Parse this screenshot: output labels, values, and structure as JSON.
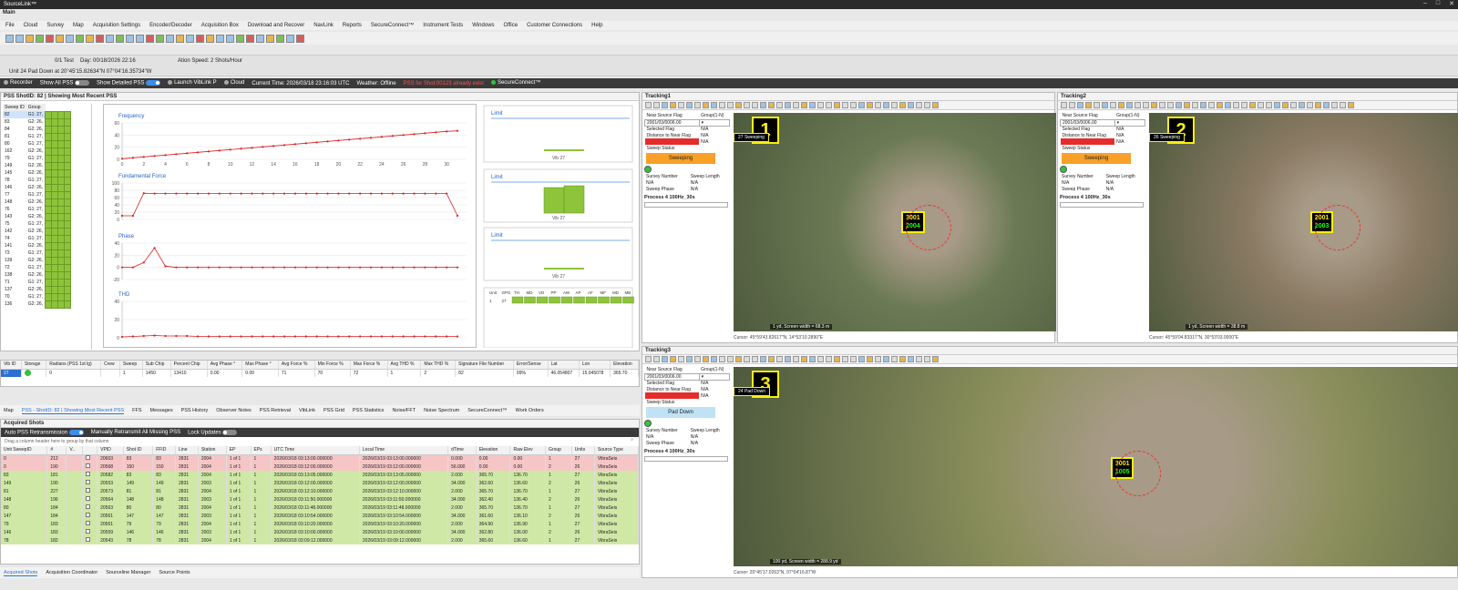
{
  "window": {
    "title": "SourceLink™",
    "main_label": "Main"
  },
  "menu": [
    "File",
    "Cloud",
    "Survey",
    "Map",
    "Acquisition Settings",
    "Encoder/Decoder",
    "Acquisition Box",
    "Download and Recover",
    "NavLink",
    "Reports",
    "SecureConnect™",
    "Instrument Tests",
    "Windows",
    "Office",
    "Customer Connections",
    "Help"
  ],
  "infobar": {
    "test_label": "0/1 Test",
    "day": "Day: 00/18/2026 22:16",
    "speed": "Ation Speed: 2 Shots/Hour",
    "unit_line": "Unit 24 Pad Down at 20°45'15.82634\"N 07°04'16.35734\"W"
  },
  "status": {
    "recorder": "Recorder",
    "show_all_pss": "Show All PSS",
    "show_detailed_pss": "Show Detailed PSS",
    "launch": "Launch VibLink P",
    "cloud": "Cloud",
    "current_time": "Current Time: 2026/03/18 23:16:03 UTC",
    "weather": "Weather: Offline",
    "alert": "PSS for Shot:00123 already exist",
    "secure": "SecureConnect™"
  },
  "pss_panel": {
    "header": "PSS  ShotID: 82  | Showing Most Recent PSS",
    "cols": [
      "Sweep ID",
      "Group"
    ],
    "rows": [
      [
        "82",
        "G1: 27,"
      ],
      [
        "83",
        "G2: 26,"
      ],
      [
        "84",
        "G2: 26,"
      ],
      [
        "81",
        "G1: 27,"
      ],
      [
        "80",
        "G1: 27,"
      ],
      [
        "162",
        "G2: 26,"
      ],
      [
        "79",
        "G1: 27,"
      ],
      [
        "149",
        "G2: 26,"
      ],
      [
        "145",
        "G2: 26,"
      ],
      [
        "78",
        "G1: 27,"
      ],
      [
        "146",
        "G2: 26,"
      ],
      [
        "77",
        "G1: 27,"
      ],
      [
        "148",
        "G2: 26,"
      ],
      [
        "76",
        "G1: 27,"
      ],
      [
        "143",
        "G2: 26,"
      ],
      [
        "75",
        "G1: 27,"
      ],
      [
        "142",
        "G2: 26,"
      ],
      [
        "74",
        "G1: 27,"
      ],
      [
        "141",
        "G2: 26,"
      ],
      [
        "73",
        "G1: 27,"
      ],
      [
        "139",
        "G2: 26,"
      ],
      [
        "72",
        "G1: 27,"
      ],
      [
        "138",
        "G2: 26,"
      ],
      [
        "71",
        "G1: 27,"
      ],
      [
        "137",
        "G2: 26,"
      ],
      [
        "70",
        "G1: 27,"
      ],
      [
        "136",
        "G2: 26,"
      ]
    ]
  },
  "charts": {
    "frequency_label": "Frequency",
    "force_label": "Fundamental Force",
    "phase_label": "Phase",
    "thd_label": "THD",
    "limit_label": "Limit",
    "vib_label": "Vib 27",
    "freq_y": [
      "60",
      "40",
      "20",
      "0"
    ],
    "x_ticks": [
      "0",
      "2",
      "4",
      "6",
      "8",
      "10",
      "12",
      "14",
      "16",
      "18",
      "20",
      "22",
      "24",
      "26",
      "28",
      "30"
    ],
    "force_y": [
      "100",
      "80",
      "60",
      "40",
      "20",
      "0"
    ],
    "phase_y": [
      "40",
      "20",
      "0",
      "-20"
    ],
    "thd_y": [
      "40",
      "20",
      "0"
    ]
  },
  "chart_data": [
    {
      "type": "line",
      "title": "Frequency",
      "x": [
        0,
        1,
        2,
        3,
        4,
        5,
        6,
        7,
        8,
        9,
        10,
        11,
        12,
        13,
        14,
        15,
        16,
        17,
        18,
        19,
        20,
        21,
        22,
        23,
        24,
        25,
        26,
        27,
        28,
        29,
        30,
        31
      ],
      "values": [
        1,
        2.5,
        4,
        5.5,
        7,
        8.5,
        10,
        11.5,
        13,
        14.5,
        16,
        17.5,
        19,
        20.5,
        22,
        23.5,
        25,
        26.5,
        28,
        29.5,
        31,
        32.5,
        34,
        35.5,
        37,
        38.5,
        40,
        41.5,
        43,
        44.5,
        46,
        47
      ],
      "ylim": [
        0,
        60
      ]
    },
    {
      "type": "line",
      "title": "Fundamental Force",
      "x": [
        0,
        1,
        2,
        3,
        4,
        5,
        6,
        7,
        8,
        9,
        10,
        11,
        12,
        13,
        14,
        15,
        16,
        17,
        18,
        19,
        20,
        21,
        22,
        23,
        24,
        25,
        26,
        27,
        28,
        29,
        30,
        31
      ],
      "values": [
        10,
        10,
        72,
        71,
        71,
        71,
        71,
        71,
        71,
        71,
        71,
        71,
        71,
        71,
        71,
        71,
        71,
        71,
        71,
        71,
        71,
        71,
        71,
        71,
        71,
        71,
        71,
        71,
        71,
        71,
        71,
        10
      ],
      "ylim": [
        0,
        100
      ]
    },
    {
      "type": "line",
      "title": "Phase",
      "x": [
        0,
        1,
        2,
        3,
        4,
        5,
        6,
        7,
        8,
        9,
        10,
        11,
        12,
        13,
        14,
        15,
        16,
        17,
        18,
        19,
        20,
        21,
        22,
        23,
        24,
        25,
        26,
        27,
        28,
        29,
        30,
        31
      ],
      "values": [
        0,
        0,
        8,
        32,
        2,
        0,
        0,
        0,
        0,
        0,
        0,
        0,
        0,
        0,
        0,
        0,
        0,
        0,
        0,
        0,
        0,
        0,
        0,
        0,
        0,
        0,
        0,
        0,
        0,
        0,
        0,
        0
      ],
      "ylim": [
        -20,
        40
      ]
    },
    {
      "type": "line",
      "title": "THD",
      "x": [
        0,
        1,
        2,
        3,
        4,
        5,
        6,
        7,
        8,
        9,
        10,
        11,
        12,
        13,
        14,
        15,
        16,
        17,
        18,
        19,
        20,
        21,
        22,
        23,
        24,
        25,
        26,
        27,
        28,
        29,
        30,
        31
      ],
      "values": [
        1,
        1.5,
        2,
        2.5,
        2,
        2,
        2,
        1.5,
        1.5,
        1.5,
        1.5,
        1.5,
        1.5,
        1.5,
        1.5,
        1.5,
        1.5,
        1.5,
        1.5,
        1.5,
        1.5,
        1.5,
        1.5,
        1.5,
        1.5,
        1.5,
        1.5,
        1.5,
        1.5,
        1.5,
        1.5,
        1.5
      ],
      "ylim": [
        0,
        40
      ]
    }
  ],
  "unit_strip": {
    "cols": [
      "Unit",
      "GPS",
      "TH",
      "MD",
      "VD",
      "PP",
      "AW",
      "AP",
      "AF",
      "MF",
      "MD",
      "MB"
    ],
    "row": [
      "1",
      "27"
    ]
  },
  "pss_detail": {
    "cols": [
      "Vib ID",
      "Storage",
      "Radians (PSS 1st lg)",
      "Crew",
      "Sweep",
      "Sub Chip",
      "Percent Chip",
      "Avg Phase °",
      "Max Phase °",
      "Avg Force %",
      "Min Force %",
      "Max Force %",
      "Avg THD %",
      "Max THD %",
      "Signature File Number",
      "Error/Sense",
      "Lat",
      "Lon",
      "Elevation"
    ],
    "row": [
      "27",
      "",
      "0",
      "",
      "1",
      "1450",
      "13410",
      "0.00",
      "0.00",
      "71",
      "70",
      "72",
      "1",
      "2",
      "82",
      "99%",
      "46.054807",
      "15.045078",
      "365.70"
    ]
  },
  "bottom_tabs": [
    "Map",
    "PSS - ShotID: 82  | Showing Most Recent PSS",
    "FFS",
    "Messages",
    "PSS History",
    "Observer Notes",
    "PSS Retrieval",
    "VibLink",
    "PSS Grid",
    "PSS Statistics",
    "Noise/FFT",
    "Noise Spectrum",
    "SecureConnect™",
    "Work Orders"
  ],
  "acquired": {
    "header": "Acquired Shots",
    "auto_pss": "Auto PSS Retransmission",
    "manual": "Manually Retransmit All Missing PSS",
    "lock": "Lock Updates",
    "group_hint": "Drag a column header here to group by that column",
    "cols": [
      "Unit SweepID",
      "#",
      "V..",
      "",
      "VPID",
      "Shot ID",
      "FFID",
      "Line",
      "Station",
      "EP",
      "EPs",
      "UTC Time",
      "Local Time",
      "dTime",
      "Elevation",
      "Raw Elev",
      "Group",
      "Units",
      "Source Type"
    ],
    "rows": [
      [
        "0",
        "212",
        "",
        "",
        "20603",
        "83",
        "83",
        "2831",
        "2004",
        "1 of 1",
        "1",
        "2026/03/18 03:13:00.000000",
        "2026/03/19 03:13:00.000000",
        "0.000",
        "0.00",
        "0.00",
        "1",
        "27",
        "VibraSeis"
      ],
      [
        "0",
        "190",
        "",
        "",
        "20568",
        "150",
        "150",
        "2831",
        "2004",
        "1 of 1",
        "1",
        "2026/03/18 03:12:00.000000",
        "2026/03/19 03:12:00.000000",
        "56.000",
        "0.00",
        "0.00",
        "2",
        "26",
        "VibraSeis"
      ],
      [
        "83",
        "181",
        "",
        "",
        "20582",
        "83",
        "83",
        "2831",
        "2004",
        "1 of 1",
        "1",
        "2026/03/18 03:13:05.000000",
        "2026/03/19 03:13:05.000000",
        "2.000",
        "365.70",
        "136.70",
        "1",
        "27",
        "VibraSeis"
      ],
      [
        "149",
        "190",
        "",
        "",
        "20553",
        "149",
        "149",
        "2831",
        "2003",
        "1 of 1",
        "1",
        "2026/03/18 03:12:00.000000",
        "2026/03/19 03:12:00.000000",
        "34.000",
        "362.60",
        "136.60",
        "2",
        "26",
        "VibraSeis"
      ],
      [
        "81",
        "227",
        "",
        "",
        "20573",
        "81",
        "81",
        "2831",
        "2004",
        "1 of 1",
        "1",
        "2026/03/18 03:12:10.000000",
        "2026/03/19 03:12:10.000000",
        "2.000",
        "365.70",
        "136.70",
        "1",
        "27",
        "VibraSeis"
      ],
      [
        "148",
        "196",
        "",
        "",
        "20564",
        "148",
        "148",
        "2831",
        "2003",
        "1 of 1",
        "1",
        "2026/03/18 03:11:50.000000",
        "2026/03/19 03:11:50.000000",
        "34.000",
        "362.40",
        "136.40",
        "2",
        "26",
        "VibraSeis"
      ],
      [
        "80",
        "184",
        "",
        "",
        "20563",
        "80",
        "80",
        "2831",
        "2004",
        "1 of 1",
        "1",
        "2026/03/18 03:11:48.000000",
        "2026/03/19 03:11:48.000000",
        "2.000",
        "365.70",
        "136.70",
        "1",
        "27",
        "VibraSeis"
      ],
      [
        "147",
        "184",
        "",
        "",
        "20561",
        "147",
        "147",
        "2831",
        "2003",
        "1 of 1",
        "1",
        "2026/03/18 03:10:54.000000",
        "2026/03/19 03:10:54.000000",
        "34.000",
        "361.60",
        "136.10",
        "2",
        "26",
        "VibraSeis"
      ],
      [
        "79",
        "183",
        "",
        "",
        "20561",
        "79",
        "79",
        "2831",
        "2004",
        "1 of 1",
        "1",
        "2026/03/18 03:10:20.000000",
        "2026/03/19 03:10:20.000000",
        "2.000",
        "364.90",
        "136.90",
        "1",
        "27",
        "VibraSeis"
      ],
      [
        "146",
        "183",
        "",
        "",
        "20559",
        "146",
        "146",
        "2831",
        "2003",
        "1 of 1",
        "1",
        "2026/03/18 03:10:00.000000",
        "2026/03/19 03:10:00.000000",
        "34.000",
        "362.80",
        "136.00",
        "2",
        "26",
        "VibraSeis"
      ],
      [
        "78",
        "182",
        "",
        "",
        "20543",
        "78",
        "78",
        "2831",
        "2004",
        "1 of 1",
        "1",
        "2026/03/18 03:09:12.000000",
        "2026/03/19 03:09:12.000000",
        "2.000",
        "365.60",
        "136.60",
        "1",
        "27",
        "VibraSeis"
      ]
    ]
  },
  "footer_tabs": [
    "Acquired Shots",
    "Acquisition Coordinator",
    "Sourceline Manager",
    "Source Points"
  ],
  "tracking": [
    {
      "title": "Tracking1",
      "num": "1",
      "status": "Sweeping",
      "status_line": "27  Sweeping",
      "process": "Process 4 100Hz_30s",
      "date": "2001/03/0006.00",
      "na": "N/A",
      "nearest_label": "Near Source Flag",
      "group_label": "Group(1-N)",
      "selected_label": "Selected Flag",
      "dist_label": "Distance to Near Flag",
      "survey_label": "Survey Number",
      "sweep_label": "Sweep Length",
      "sweep_phase": "Sweep Phase",
      "sweep_status": "Sweep Status",
      "vp1": "3001",
      "vp2": "2004",
      "scale": "1 yd, Screen width = 68.3 m",
      "cursor": "Cursor: 45°59'43.82617\"N, 14°53'10.2890\"E"
    },
    {
      "title": "Tracking2",
      "num": "2",
      "status": "Sweeping",
      "status_line": "26  Sweeping",
      "process": "Process 4 100Hz_30s",
      "date": "2001/03/0006.00",
      "na": "N/A",
      "nearest_label": "Near Source Flag",
      "group_label": "Group(1-N)",
      "selected_label": "Selected Flag",
      "dist_label": "Distance to Near Flag",
      "survey_label": "Survey Number",
      "sweep_label": "Sweep Length",
      "sweep_phase": "Sweep Phase",
      "sweep_status": "Sweep Status",
      "vp1": "2001",
      "vp2": "2003",
      "scale": "1 yd, Screen width = 38.8 m",
      "cursor": "Cursor: 45°59'04.83317\"N, 30°53'03.0000\"E"
    },
    {
      "title": "Tracking3",
      "num": "3",
      "status": "Pad Down",
      "status_line": "24  Pad Down",
      "status_line2": "25  Pad Down",
      "process": "Process 4 100Hz_30s",
      "date": "2001/03/0006.00",
      "na": "N/A",
      "nearest_label": "Near Source Flag",
      "group_label": "Group(1-N)",
      "selected_label": "Selected Flag",
      "dist_label": "Distance to Near Flag",
      "survey_label": "Survey Number",
      "sweep_label": "Sweep Length",
      "sweep_phase": "Sweep Phase",
      "sweep_status": "Sweep Status",
      "vp1": "3001",
      "vp2": "1005",
      "scale": "100 yd, Screen width = 288.9 yd",
      "cursor": "Cursor: 20°45'17.0263\"N, 07°04'16.87'W"
    }
  ],
  "colors": {
    "accent": "#2c6fd1",
    "sweep": "#f8a027",
    "paddown": "#bfe3f4",
    "good": "#8ec43a",
    "alert": "#ff4040"
  }
}
